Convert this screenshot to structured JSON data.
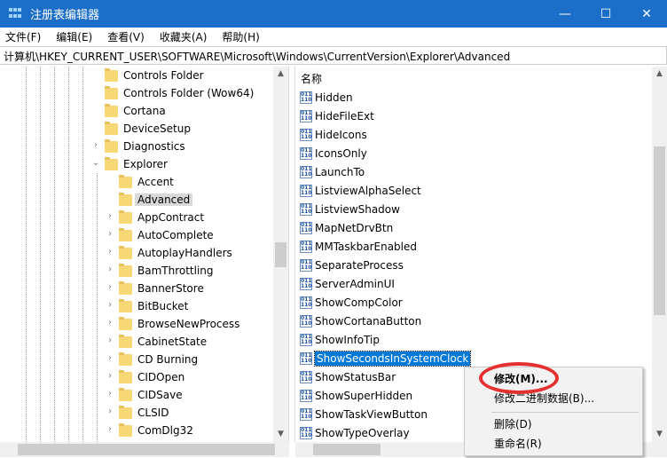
{
  "window": {
    "title": "注册表编辑器",
    "minimize": "—",
    "maximize": "☐",
    "close": "✕"
  },
  "menu": [
    "文件(F)",
    "编辑(E)",
    "查看(V)",
    "收藏夹(A)",
    "帮助(H)"
  ],
  "address": "计算机\\HKEY_CURRENT_USER\\SOFTWARE\\Microsoft\\Windows\\CurrentVersion\\Explorer\\Advanced",
  "tree": [
    {
      "label": "Controls Folder",
      "level": 1,
      "exp": ""
    },
    {
      "label": "Controls Folder (Wow64)",
      "level": 1,
      "exp": ""
    },
    {
      "label": "Cortana",
      "level": 1,
      "exp": ""
    },
    {
      "label": "DeviceSetup",
      "level": 1,
      "exp": ""
    },
    {
      "label": "Diagnostics",
      "level": 1,
      "exp": "›"
    },
    {
      "label": "Explorer",
      "level": 1,
      "exp": "⌄"
    },
    {
      "label": "Accent",
      "level": 2,
      "exp": ""
    },
    {
      "label": "Advanced",
      "level": 2,
      "exp": "",
      "selected": true
    },
    {
      "label": "AppContract",
      "level": 2,
      "exp": "›"
    },
    {
      "label": "AutoComplete",
      "level": 2,
      "exp": "›"
    },
    {
      "label": "AutoplayHandlers",
      "level": 2,
      "exp": "›"
    },
    {
      "label": "BamThrottling",
      "level": 2,
      "exp": "›"
    },
    {
      "label": "BannerStore",
      "level": 2,
      "exp": "›"
    },
    {
      "label": "BitBucket",
      "level": 2,
      "exp": "›"
    },
    {
      "label": "BrowseNewProcess",
      "level": 2,
      "exp": "›"
    },
    {
      "label": "CabinetState",
      "level": 2,
      "exp": "›"
    },
    {
      "label": "CD Burning",
      "level": 2,
      "exp": "›"
    },
    {
      "label": "CIDOpen",
      "level": 2,
      "exp": "›"
    },
    {
      "label": "CIDSave",
      "level": 2,
      "exp": "›"
    },
    {
      "label": "CLSID",
      "level": 2,
      "exp": "›"
    },
    {
      "label": "ComDlg32",
      "level": 2,
      "exp": "›"
    }
  ],
  "list_header": "名称",
  "values": [
    "Hidden",
    "HideFileExt",
    "HideIcons",
    "IconsOnly",
    "LaunchTo",
    "ListviewAlphaSelect",
    "ListviewShadow",
    "MapNetDrvBtn",
    "MMTaskbarEnabled",
    "SeparateProcess",
    "ServerAdminUI",
    "ShowCompColor",
    "ShowCortanaButton",
    "ShowInfoTip",
    "ShowSecondsInSystemClock",
    "ShowStatusBar",
    "ShowSuperHidden",
    "ShowTaskViewButton",
    "ShowTypeOverlay"
  ],
  "selected_value": "ShowSecondsInSystemClock",
  "context_menu": [
    "修改(M)...",
    "修改二进制数据(B)...",
    "删除(D)",
    "重命名(R)"
  ]
}
